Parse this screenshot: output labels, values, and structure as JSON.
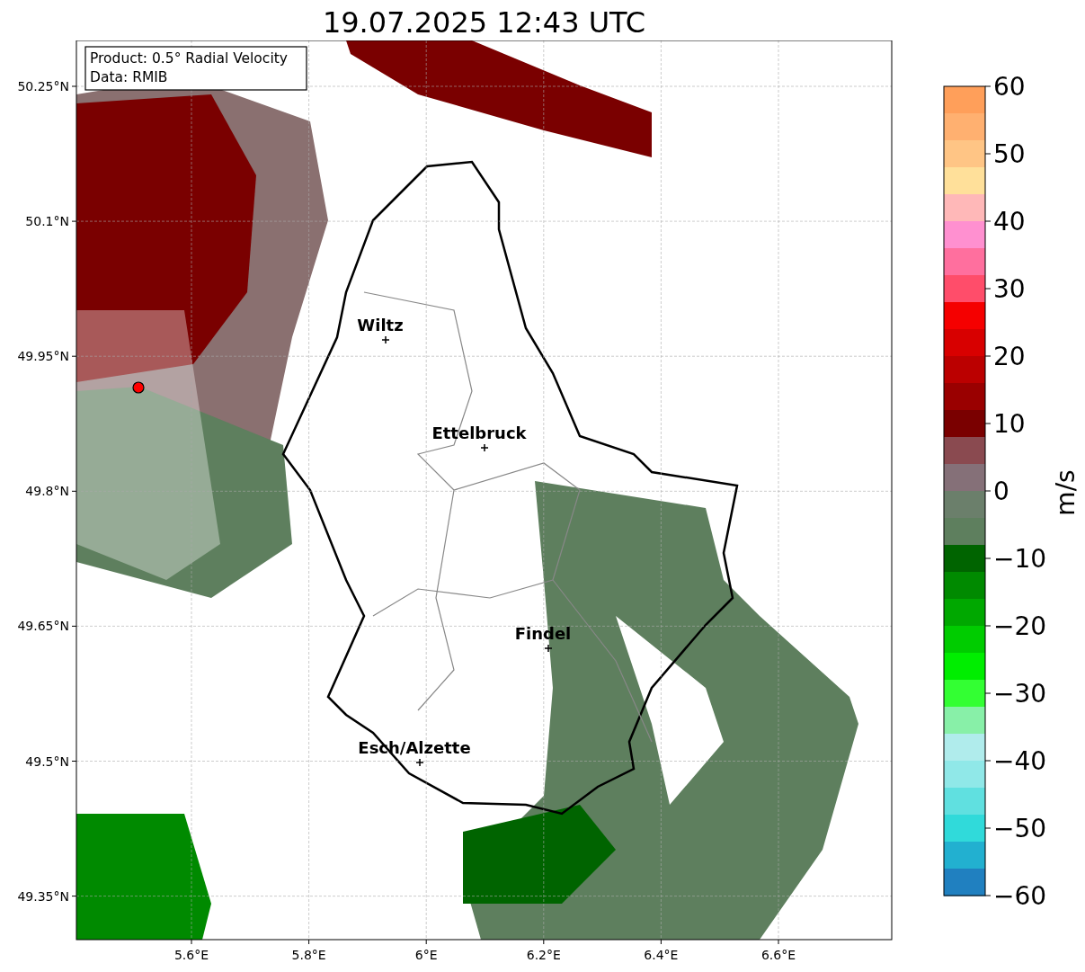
{
  "title": "19.07.2025 12:43 UTC",
  "info_box": {
    "lines": [
      "Product: 0.5° Radial Velocity",
      "Data: RMIB"
    ]
  },
  "map": {
    "lat_ticks": [
      "50.25°N",
      "50.1°N",
      "49.95°N",
      "49.8°N",
      "49.65°N",
      "49.5°N",
      "49.35°N"
    ],
    "lon_ticks": [
      "5.6°E",
      "5.8°E",
      "6°E",
      "6.2°E",
      "6.4°E",
      "6.6°E"
    ],
    "cities": [
      {
        "name": "Wiltz"
      },
      {
        "name": "Ettelbruck"
      },
      {
        "name": "Findel"
      },
      {
        "name": "Esch/Alzette"
      }
    ]
  },
  "colorbar": {
    "label": "m/s",
    "ticks": [
      "60",
      "50",
      "40",
      "30",
      "20",
      "10",
      "0",
      "−10",
      "−20",
      "−30",
      "−40",
      "−50",
      "−60"
    ],
    "bands": [
      {
        "color": "#ff9f5a"
      },
      {
        "color": "#ffb070"
      },
      {
        "color": "#ffc585"
      },
      {
        "color": "#ffe09a"
      },
      {
        "color": "#ffb8b8"
      },
      {
        "color": "#ff90d0"
      },
      {
        "color": "#ff6f9e"
      },
      {
        "color": "#ff4d6a"
      },
      {
        "color": "#f50000"
      },
      {
        "color": "#d80000"
      },
      {
        "color": "#bb0000"
      },
      {
        "color": "#9a0000"
      },
      {
        "color": "#7a0000"
      },
      {
        "color": "#8a4a50"
      },
      {
        "color": "#857078"
      },
      {
        "color": "#6b7f6b"
      },
      {
        "color": "#5e7f5e"
      },
      {
        "color": "#006400"
      },
      {
        "color": "#008a00"
      },
      {
        "color": "#00a800"
      },
      {
        "color": "#00cc00"
      },
      {
        "color": "#00ee00"
      },
      {
        "color": "#33ff33"
      },
      {
        "color": "#88f0a8"
      },
      {
        "color": "#b0ecec"
      },
      {
        "color": "#90e8e8"
      },
      {
        "color": "#60e0e0"
      },
      {
        "color": "#30dada"
      },
      {
        "color": "#22b0d0"
      },
      {
        "color": "#2080c0"
      }
    ]
  }
}
